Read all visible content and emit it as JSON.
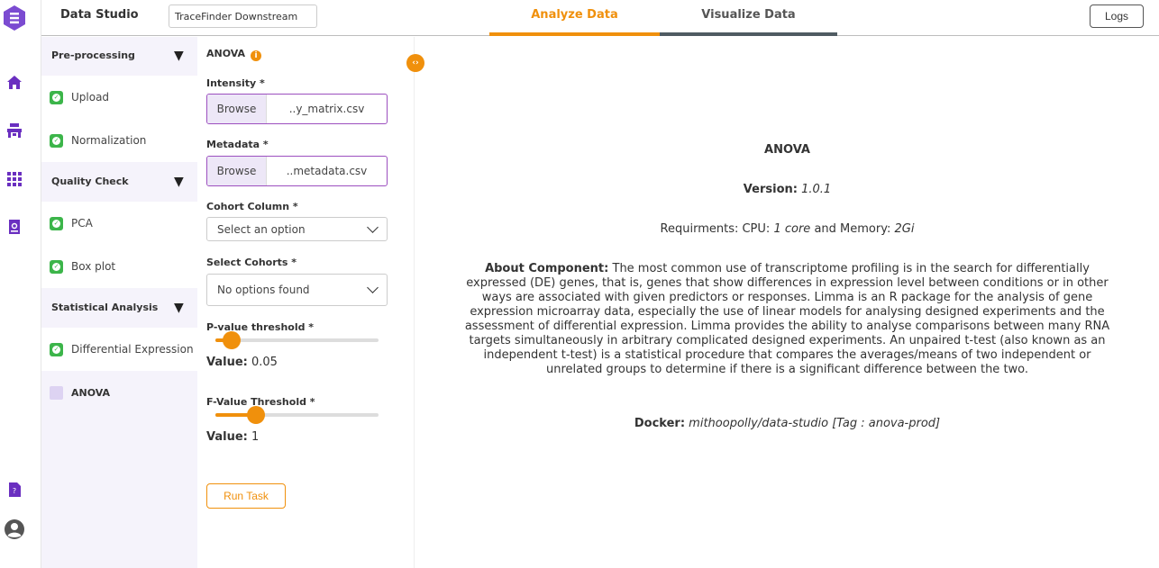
{
  "header": {
    "app_title": "Data Studio",
    "project_name": "TraceFinder Downstream",
    "tabs": [
      {
        "label": "Analyze Data",
        "active": true
      },
      {
        "label": "Visualize Data",
        "active": false
      }
    ],
    "logs_label": "Logs"
  },
  "rail": {
    "icons": [
      "logo-icon",
      "home-icon",
      "workbench-icon",
      "grid-apps-icon",
      "report-icon",
      "help-doc-icon",
      "user-account-icon"
    ]
  },
  "steps": {
    "sections": [
      {
        "label": "Pre-processing",
        "items": [
          "Upload",
          "Normalization"
        ]
      },
      {
        "label": "Quality Check",
        "items": [
          "PCA",
          "Box plot"
        ]
      },
      {
        "label": "Statistical Analysis",
        "items": [
          "Differential Expression",
          "ANOVA"
        ]
      }
    ],
    "caret": "▼"
  },
  "form": {
    "title": "ANOVA",
    "intensity_label": "Intensity *",
    "intensity_browse": "Browse",
    "intensity_file": "..y_matrix.csv",
    "metadata_label": "Metadata *",
    "metadata_browse": "Browse",
    "metadata_file": "..metadata.csv",
    "cohort_column_label": "Cohort Column *",
    "cohort_column_value": "Select an option",
    "select_cohorts_label": "Select Cohorts *",
    "select_cohorts_value": "No options found",
    "pvalue_label": "P-value threshold *",
    "pvalue_value_prefix": "Value:",
    "pvalue_value": "0.05",
    "pvalue_fraction": 0.1,
    "fvalue_label": "F-Value Threshold *",
    "fvalue_value_prefix": "Value:",
    "fvalue_value": "1",
    "fvalue_fraction": 0.25,
    "run_label": "Run Task"
  },
  "description": {
    "title": "ANOVA",
    "version_label": "Version:",
    "version": "1.0.1",
    "req_prefix": "Requirments: CPU:",
    "cpu": "1 core",
    "req_mid": "and Memory:",
    "memory": "2Gi",
    "about_label": "About Component:",
    "about_text": "The most common use of transcriptome profiling is in the search for differentially expressed (DE) genes, that is, genes that show differences in expression level between conditions or in other ways are associated with given predictors or responses. Limma is an R package for the analysis of gene expression microarray data, especially the use of linear models for analysing designed experiments and the assessment of differential expression. Limma provides the ability to analyse comparisons between many RNA targets simultaneously in arbitrary complicated designed experiments. An unpaired t-test (also known as an independent t-test) is a statistical procedure that compares the averages/means of two independent or unrelated groups to determine if there is a significant difference between the two.",
    "docker_label": "Docker:",
    "docker_value": "mithoopolly/data-studio [Tag : anova-prod]"
  },
  "colors": {
    "accent": "#f0900c",
    "brand": "#6a2fc0",
    "done": "#3cb54a",
    "sidebar_bg": "#f5f3fb"
  }
}
